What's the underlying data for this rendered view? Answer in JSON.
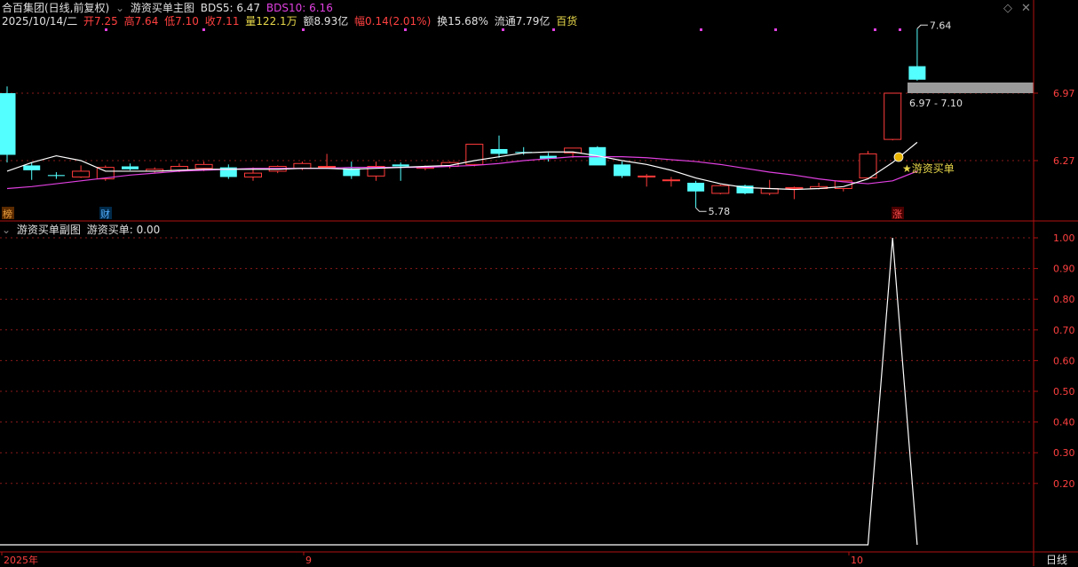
{
  "header": {
    "stock": "合百集团(日线,前复权)",
    "indicator_name": "游资买单主图",
    "bds5": "BDS5: 6.47",
    "bds10": "BDS10: 6.16",
    "date": "2025/10/14/二",
    "open": "开7.25",
    "high": "高7.64",
    "low": "低7.10",
    "close": "收7.11",
    "volume": "量122.1万",
    "amount": "额8.93亿",
    "change": "幅0.14(2.01%)",
    "turnover": "换15.68%",
    "float_cap": "流通7.79亿",
    "sector": "百货",
    "sub_title": "游资买单副图",
    "sub_value": "游资买单: 0.00",
    "timeframe": "日线"
  },
  "colors": {
    "up": "#ff3b3b",
    "down": "#54ffff",
    "ma5": "#ffffff",
    "ma10": "#e040e0",
    "grid": "#8b1a1a",
    "axis": "#b01010"
  },
  "chart_data": [
    {
      "type": "candlestick",
      "title": "",
      "y_ticks": [
        6.27,
        6.97
      ],
      "ylim": [
        5.6,
        7.8
      ],
      "annotations": {
        "high_label": "7.64",
        "low_label": "5.78",
        "range_label": "6.97 - 7.10",
        "signal_label": "★游资买单",
        "markers": [
          "榜",
          "财",
          "涨"
        ]
      },
      "candles": [
        {
          "o": 6.97,
          "h": 7.04,
          "l": 6.25,
          "c": 6.33
        },
        {
          "o": 6.22,
          "h": 6.25,
          "l": 6.07,
          "c": 6.17
        },
        {
          "o": 6.12,
          "h": 6.15,
          "l": 6.08,
          "c": 6.11
        },
        {
          "o": 6.1,
          "h": 6.22,
          "l": 6.09,
          "c": 6.16
        },
        {
          "o": 6.08,
          "h": 6.22,
          "l": 6.06,
          "c": 6.2
        },
        {
          "o": 6.21,
          "h": 6.24,
          "l": 6.17,
          "c": 6.18
        },
        {
          "o": 6.16,
          "h": 6.2,
          "l": 6.14,
          "c": 6.18
        },
        {
          "o": 6.17,
          "h": 6.24,
          "l": 6.15,
          "c": 6.21
        },
        {
          "o": 6.19,
          "h": 6.26,
          "l": 6.16,
          "c": 6.23
        },
        {
          "o": 6.2,
          "h": 6.23,
          "l": 6.08,
          "c": 6.1
        },
        {
          "o": 6.1,
          "h": 6.2,
          "l": 6.06,
          "c": 6.14
        },
        {
          "o": 6.16,
          "h": 6.22,
          "l": 6.14,
          "c": 6.21
        },
        {
          "o": 6.19,
          "h": 6.26,
          "l": 6.17,
          "c": 6.24
        },
        {
          "o": 6.21,
          "h": 6.34,
          "l": 6.19,
          "c": 6.21
        },
        {
          "o": 6.19,
          "h": 6.26,
          "l": 6.08,
          "c": 6.11
        },
        {
          "o": 6.11,
          "h": 6.26,
          "l": 6.06,
          "c": 6.21
        },
        {
          "o": 6.23,
          "h": 6.25,
          "l": 6.06,
          "c": 6.21
        },
        {
          "o": 6.19,
          "h": 6.22,
          "l": 6.17,
          "c": 6.2
        },
        {
          "o": 6.21,
          "h": 6.26,
          "l": 6.19,
          "c": 6.25
        },
        {
          "o": 6.23,
          "h": 6.44,
          "l": 6.21,
          "c": 6.44
        },
        {
          "o": 6.39,
          "h": 6.53,
          "l": 6.3,
          "c": 6.34
        },
        {
          "o": 6.36,
          "h": 6.41,
          "l": 6.33,
          "c": 6.35
        },
        {
          "o": 6.32,
          "h": 6.35,
          "l": 6.26,
          "c": 6.29
        },
        {
          "o": 6.35,
          "h": 6.38,
          "l": 6.3,
          "c": 6.4
        },
        {
          "o": 6.41,
          "h": 6.42,
          "l": 6.23,
          "c": 6.22
        },
        {
          "o": 6.23,
          "h": 6.26,
          "l": 6.09,
          "c": 6.11
        },
        {
          "o": 6.1,
          "h": 6.13,
          "l": 6.0,
          "c": 6.11
        },
        {
          "o": 6.07,
          "h": 6.1,
          "l": 6.0,
          "c": 6.07
        },
        {
          "o": 6.04,
          "h": 6.06,
          "l": 5.78,
          "c": 5.95
        },
        {
          "o": 5.93,
          "h": 6.02,
          "l": 5.92,
          "c": 6.01
        },
        {
          "o": 6.01,
          "h": 6.02,
          "l": 5.92,
          "c": 5.93
        },
        {
          "o": 5.93,
          "h": 6.07,
          "l": 5.91,
          "c": 5.98
        },
        {
          "o": 5.99,
          "h": 6.0,
          "l": 5.87,
          "c": 5.99
        },
        {
          "o": 5.98,
          "h": 6.04,
          "l": 5.97,
          "c": 6.0
        },
        {
          "o": 5.98,
          "h": 6.05,
          "l": 5.95,
          "c": 6.06
        },
        {
          "o": 6.09,
          "h": 6.37,
          "l": 6.08,
          "c": 6.34
        },
        {
          "o": 6.49,
          "h": 6.97,
          "l": 6.48,
          "c": 6.97
        },
        {
          "o": 7.25,
          "h": 7.64,
          "l": 7.1,
          "c": 7.11
        }
      ],
      "ma5": [
        6.16,
        6.25,
        6.32,
        6.27,
        6.16,
        6.16,
        6.16,
        6.17,
        6.18,
        6.18,
        6.18,
        6.18,
        6.19,
        6.19,
        6.18,
        6.19,
        6.2,
        6.21,
        6.22,
        6.27,
        6.31,
        6.35,
        6.36,
        6.36,
        6.32,
        6.27,
        6.23,
        6.17,
        6.09,
        6.03,
        5.99,
        5.98,
        5.97,
        5.98,
        6.0,
        6.08,
        6.25,
        6.46
      ],
      "ma10": [
        5.98,
        6.0,
        6.03,
        6.06,
        6.09,
        6.12,
        6.14,
        6.16,
        6.17,
        6.18,
        6.19,
        6.19,
        6.19,
        6.19,
        6.2,
        6.2,
        6.2,
        6.2,
        6.21,
        6.22,
        6.24,
        6.27,
        6.29,
        6.31,
        6.31,
        6.31,
        6.3,
        6.28,
        6.26,
        6.23,
        6.19,
        6.15,
        6.12,
        6.08,
        6.05,
        6.03,
        6.06,
        6.16
      ]
    },
    {
      "type": "line",
      "title": "",
      "y_ticks": [
        0.2,
        0.3,
        0.4,
        0.5,
        0.6,
        0.7,
        0.8,
        0.9,
        1.0
      ],
      "ylim": [
        0.0,
        1.0
      ],
      "series": [
        {
          "values": [
            0,
            0,
            0,
            0,
            0,
            0,
            0,
            0,
            0,
            0,
            0,
            0,
            0,
            0,
            0,
            0,
            0,
            0,
            0,
            0,
            0,
            0,
            0,
            0,
            0,
            0,
            0,
            0,
            0,
            0,
            0,
            0,
            0,
            0,
            0,
            0,
            1,
            0
          ]
        }
      ]
    }
  ],
  "x_axis_labels": [
    "2025年",
    "9",
    "10"
  ]
}
